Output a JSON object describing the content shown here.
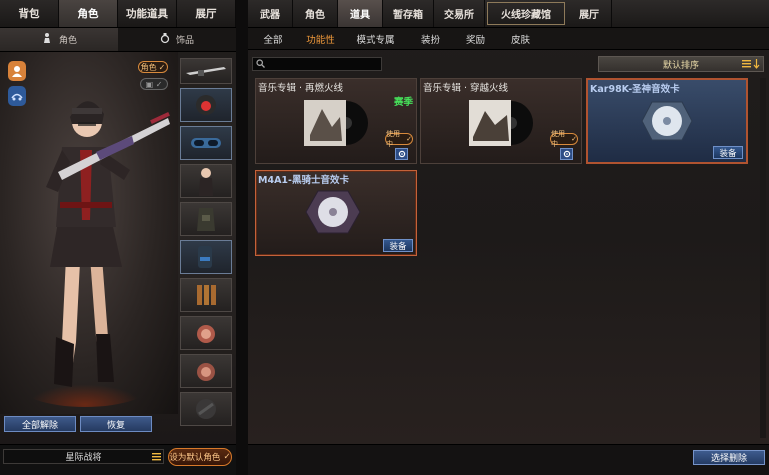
{
  "left_tabs": [
    "背包",
    "角色",
    "功能道具",
    "展厅"
  ],
  "left_active_tab": 1,
  "left_sub": {
    "character_label": "角色",
    "accessory_label": "饰品"
  },
  "stage": {
    "role_tag": "角色"
  },
  "left_buttons": {
    "remove_all": "全部解除",
    "restore": "恢复"
  },
  "left_bottom": {
    "role_select_value": "星际战将",
    "set_default": "设为默认角色"
  },
  "right_tabs": [
    "武器",
    "角色",
    "道具",
    "暂存箱",
    "交易所",
    "火线珍藏馆",
    "展厅"
  ],
  "right_active_tab": 2,
  "right_sub": [
    "全部",
    "功能性",
    "模式专属",
    "装扮",
    "奖励",
    "皮肤"
  ],
  "right_sub_active": 1,
  "sort": {
    "label": "默认排序"
  },
  "cards": [
    {
      "title": "音乐专辑 · 再燃火线",
      "badge": "赛季",
      "status": "使用中",
      "type": "album"
    },
    {
      "title": "音乐专辑 · 穿越火线",
      "status": "使用中",
      "type": "album"
    },
    {
      "title": "Kar98K-圣神音效卡",
      "equip": "装备",
      "type": "card"
    },
    {
      "title": "M4A1-黑骑士音效卡",
      "equip": "装备",
      "type": "card"
    }
  ],
  "bottom": {
    "select_remove": "选择删除"
  },
  "colors": {
    "accent_orange": "#f29a3b",
    "equip_blue": "#34588f",
    "badge_green": "#46e05a"
  }
}
